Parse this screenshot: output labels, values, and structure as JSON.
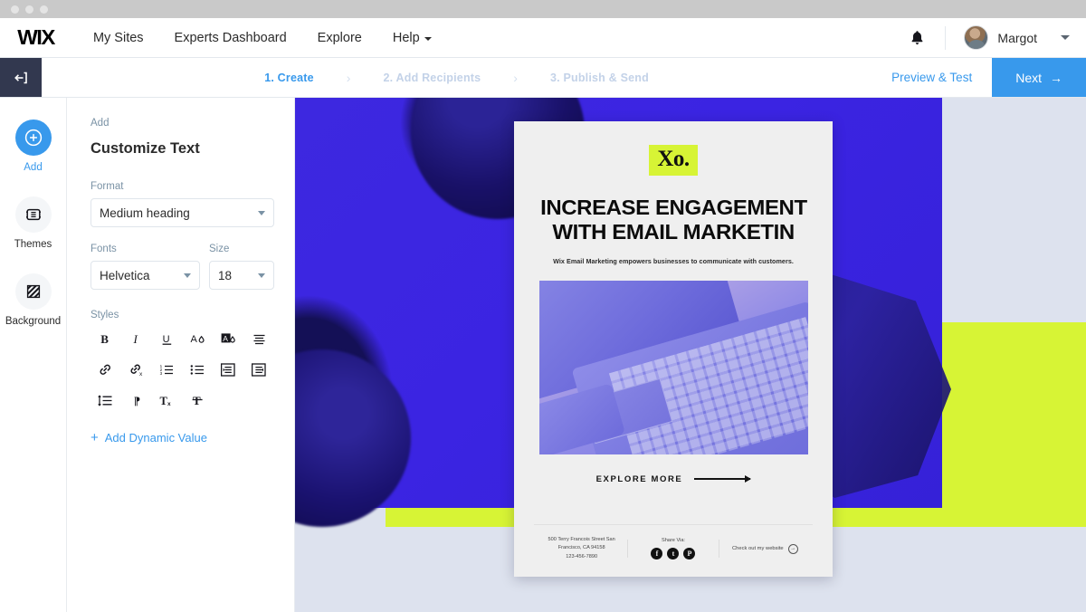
{
  "window": {
    "dots": 3
  },
  "topnav": {
    "logo": "WIX",
    "links": [
      {
        "label": "My Sites",
        "caret": false
      },
      {
        "label": "Experts Dashboard",
        "caret": false
      },
      {
        "label": "Explore",
        "caret": false
      },
      {
        "label": "Help",
        "caret": true
      }
    ],
    "bell_icon": "bell-icon",
    "user": {
      "name": "Margot",
      "avatar_icon": "avatar",
      "caret_icon": "chevron-down-icon"
    }
  },
  "editbar": {
    "back_icon": "back-arrow-icon",
    "steps": [
      {
        "label": "1. Create",
        "active": true
      },
      {
        "label": "2. Add Recipients",
        "active": false
      },
      {
        "label": "3. Publish & Send",
        "active": false
      }
    ],
    "separator": "›",
    "preview_label": "Preview & Test",
    "next_label": "Next",
    "next_arrow": "→",
    "accent_color": "#3899ec"
  },
  "rail": {
    "items": [
      {
        "label": "Add",
        "icon": "plus-circle-icon",
        "active": true
      },
      {
        "label": "Themes",
        "icon": "themes-icon",
        "active": false
      },
      {
        "label": "Background",
        "icon": "background-hatch-icon",
        "active": false
      }
    ]
  },
  "panel": {
    "kicker": "Add",
    "title": "Customize Text",
    "format": {
      "label": "Format",
      "value": "Medium heading"
    },
    "fonts": {
      "label": "Fonts",
      "value": "Helvetica"
    },
    "size": {
      "label": "Size",
      "value": "18"
    },
    "styles_label": "Styles",
    "styles": [
      {
        "name": "bold-icon",
        "glyph": "B"
      },
      {
        "name": "italic-icon",
        "glyph": "I"
      },
      {
        "name": "underline-icon",
        "glyph": "U"
      },
      {
        "name": "text-color-icon",
        "glyph": "A"
      },
      {
        "name": "highlight-color-icon",
        "glyph": "A"
      },
      {
        "name": "align-icon",
        "glyph": "≡"
      },
      {
        "name": "link-icon",
        "glyph": "🔗"
      },
      {
        "name": "unlink-icon",
        "glyph": "🔗"
      },
      {
        "name": "ordered-list-icon",
        "glyph": "1≡"
      },
      {
        "name": "bullet-list-icon",
        "glyph": "•≡"
      },
      {
        "name": "indent-icon",
        "glyph": "→≡"
      },
      {
        "name": "outdent-icon",
        "glyph": "←≡"
      },
      {
        "name": "line-spacing-icon",
        "glyph": "↕≡"
      },
      {
        "name": "text-direction-icon",
        "glyph": "¶"
      },
      {
        "name": "clear-format-icon",
        "glyph": "Tx"
      },
      {
        "name": "text-style-icon",
        "glyph": "T"
      }
    ],
    "dynamic_value": {
      "plus": "+",
      "label": "Add Dynamic Value"
    }
  },
  "canvas": {
    "background_color": "#dde2ee",
    "block_color": "#3b24e2",
    "accent_lime": "#d7f435"
  },
  "email": {
    "brand": "Xo.",
    "headline_line1": "INCREASE ENGAGEMENT",
    "headline_line2": "WITH EMAIL MARKETIN",
    "subhead": "Wix Email Marketing empowers businesses to communicate with customers.",
    "photo_alt": "blue-toned laptop keyboard photo",
    "cta_label": "EXPLORE MORE",
    "footer": {
      "address_line1": "500 Terry Francois Street San",
      "address_line2": "Francisco, CA 94158",
      "address_line3": "123-456-7890",
      "share_label": "Share Via:",
      "socials": [
        {
          "name": "facebook-icon",
          "glyph": "f"
        },
        {
          "name": "twitter-icon",
          "glyph": "t"
        },
        {
          "name": "pinterest-icon",
          "glyph": "P"
        }
      ],
      "website_label": "Check out my website",
      "website_arrow": "→"
    }
  }
}
